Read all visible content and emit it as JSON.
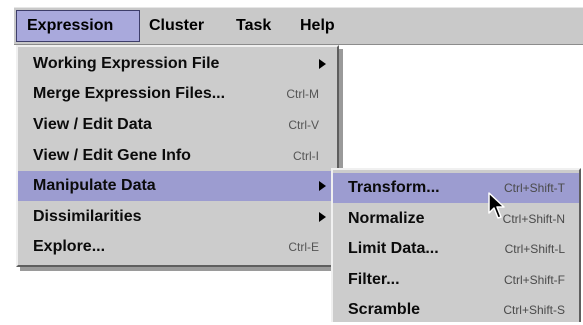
{
  "menubar": {
    "items": [
      {
        "label": "Expression"
      },
      {
        "label": "Cluster"
      },
      {
        "label": "Task"
      },
      {
        "label": "Help"
      }
    ]
  },
  "expression_menu": {
    "items": [
      {
        "label": "Working Expression File",
        "shortcut": "",
        "submenu": true
      },
      {
        "label": "Merge Expression Files...",
        "shortcut": "Ctrl-M"
      },
      {
        "label": "View / Edit Data",
        "shortcut": "Ctrl-V"
      },
      {
        "label": "View / Edit Gene Info",
        "shortcut": "Ctrl-I"
      },
      {
        "label": "Manipulate Data",
        "shortcut": "",
        "submenu": true,
        "active": true
      },
      {
        "label": "Dissimilarities",
        "shortcut": "",
        "submenu": true
      },
      {
        "label": "Explore...",
        "shortcut": "Ctrl-E"
      }
    ]
  },
  "manipulate_submenu": {
    "items": [
      {
        "label": "Transform...",
        "shortcut": "Ctrl+Shift-T",
        "active": true
      },
      {
        "label": "Normalize",
        "shortcut": "Ctrl+Shift-N"
      },
      {
        "label": "Limit Data...",
        "shortcut": "Ctrl+Shift-L"
      },
      {
        "label": "Filter...",
        "shortcut": "Ctrl+Shift-F"
      },
      {
        "label": "Scramble",
        "shortcut": "Ctrl+Shift-S"
      }
    ]
  },
  "colors": {
    "menubar_bg": "#c9c9c9",
    "menu_bg": "#cccccc",
    "highlight": "#9c9cd0",
    "menubar_selected": "#a9a9dc"
  },
  "icons": {
    "submenu_arrow": "submenu-arrow-icon",
    "pointer": "mouse-pointer-icon"
  }
}
